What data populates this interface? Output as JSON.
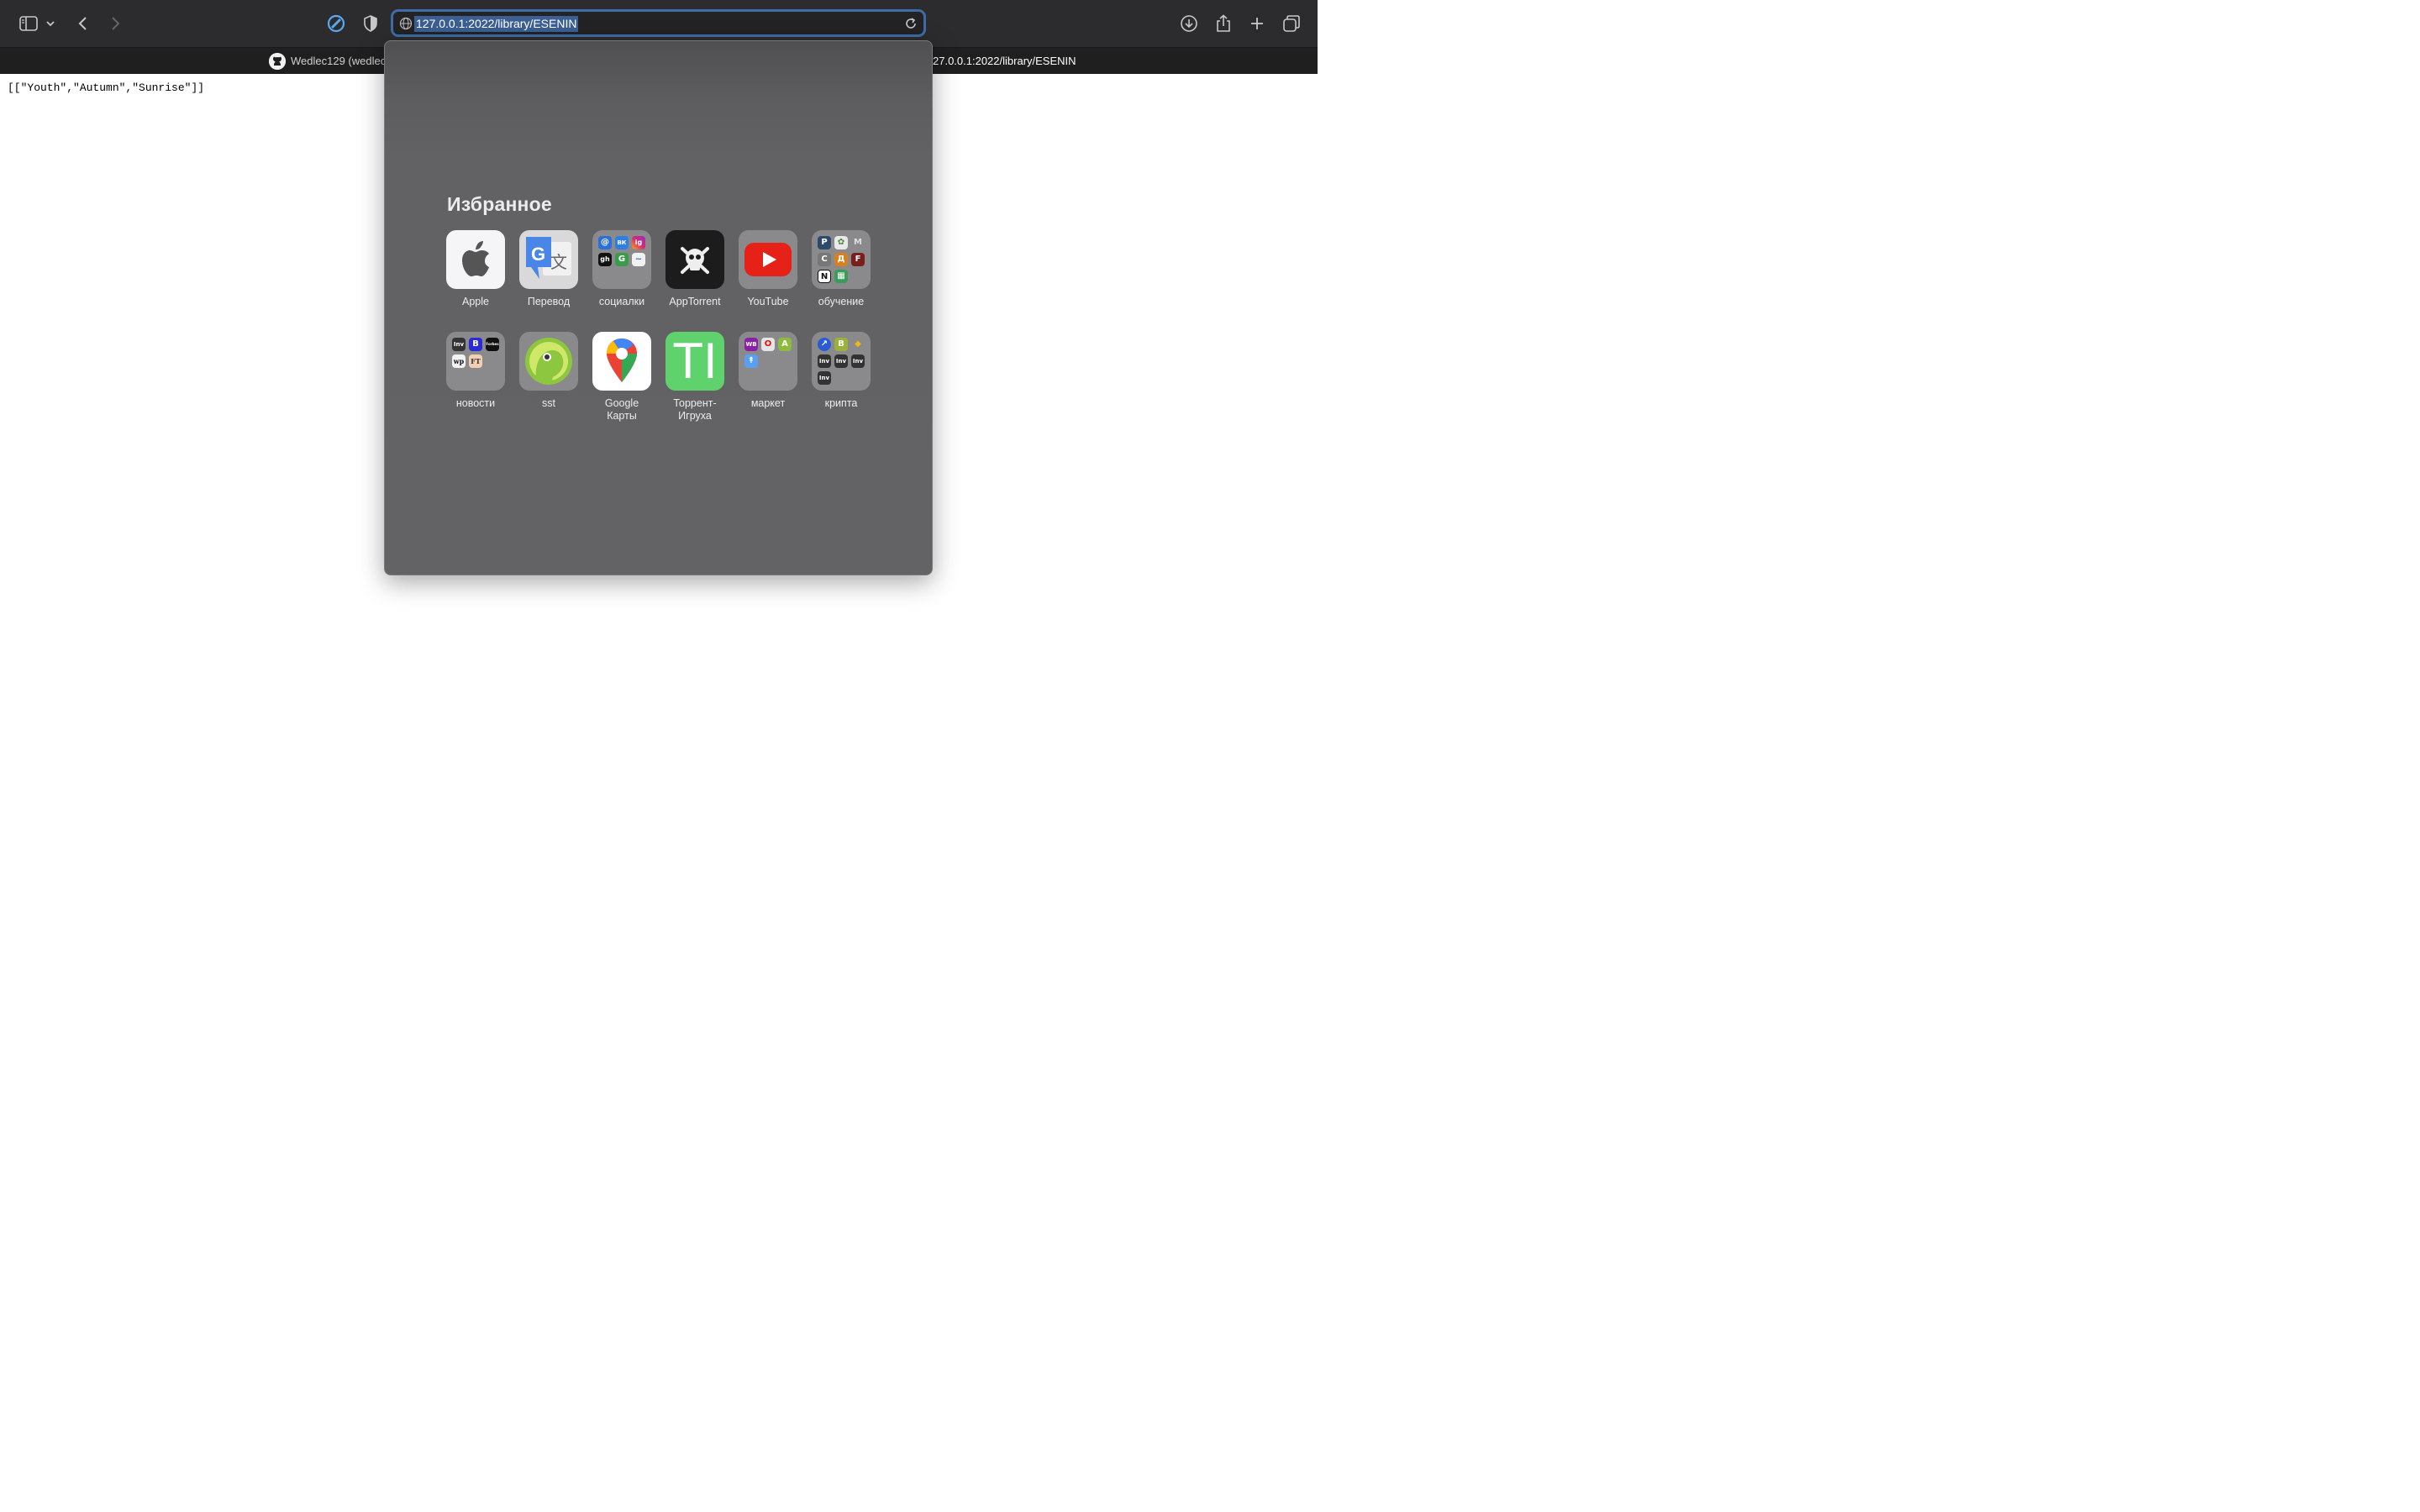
{
  "browser": {
    "url": "127.0.0.1:2022/library/ESENIN",
    "tabs": [
      {
        "title": "Wedlec129 (wedlec"
      },
      {
        "title": "27.0.0.1:2022/library/ESENIN"
      }
    ]
  },
  "page": {
    "body_text": "[[\"Youth\",\"Autumn\",\"Sunrise\"]]"
  },
  "favorites": {
    "heading": "Избранное",
    "items": [
      {
        "label": "Apple",
        "icon": "apple-logo-icon"
      },
      {
        "label": "Перевод",
        "icon": "google-translate-icon"
      },
      {
        "label": "социалки",
        "icon": "folder-icon"
      },
      {
        "label": "AppTorrent",
        "icon": "skull-icon"
      },
      {
        "label": "YouTube",
        "icon": "youtube-icon"
      },
      {
        "label": "обучение",
        "icon": "folder-icon"
      },
      {
        "label": "новости",
        "icon": "folder-icon"
      },
      {
        "label": "sst",
        "icon": "gecko-icon"
      },
      {
        "label": "Google\nКарты",
        "icon": "google-maps-icon"
      },
      {
        "label": "Торрент-\nИгруха",
        "icon": "ti-letters-icon"
      },
      {
        "label": "маркет",
        "icon": "folder-icon"
      },
      {
        "label": "крипта",
        "icon": "folder-icon"
      }
    ],
    "mini_icons": {
      "social": [
        "@",
        "ВК",
        "ig",
        "gh",
        "G",
        "~"
      ],
      "study": [
        "P",
        "✿",
        "M",
        "C",
        "Д",
        "F",
        "N",
        "▦"
      ],
      "news": [
        "Inv",
        "B",
        "Forbes",
        "wp",
        "FT"
      ],
      "market": [
        "WB",
        "O",
        "A",
        "↟"
      ],
      "crypto": [
        "↗",
        "B",
        "◆",
        "Inv",
        "Inv",
        "Inv",
        "Inv"
      ],
      "ti": "TI"
    }
  },
  "colors": {
    "url_highlight": "#3b5f93",
    "focus_ring": "#3d6da6",
    "youtube_red": "#e62117",
    "ti_green": "#5fd16d"
  }
}
